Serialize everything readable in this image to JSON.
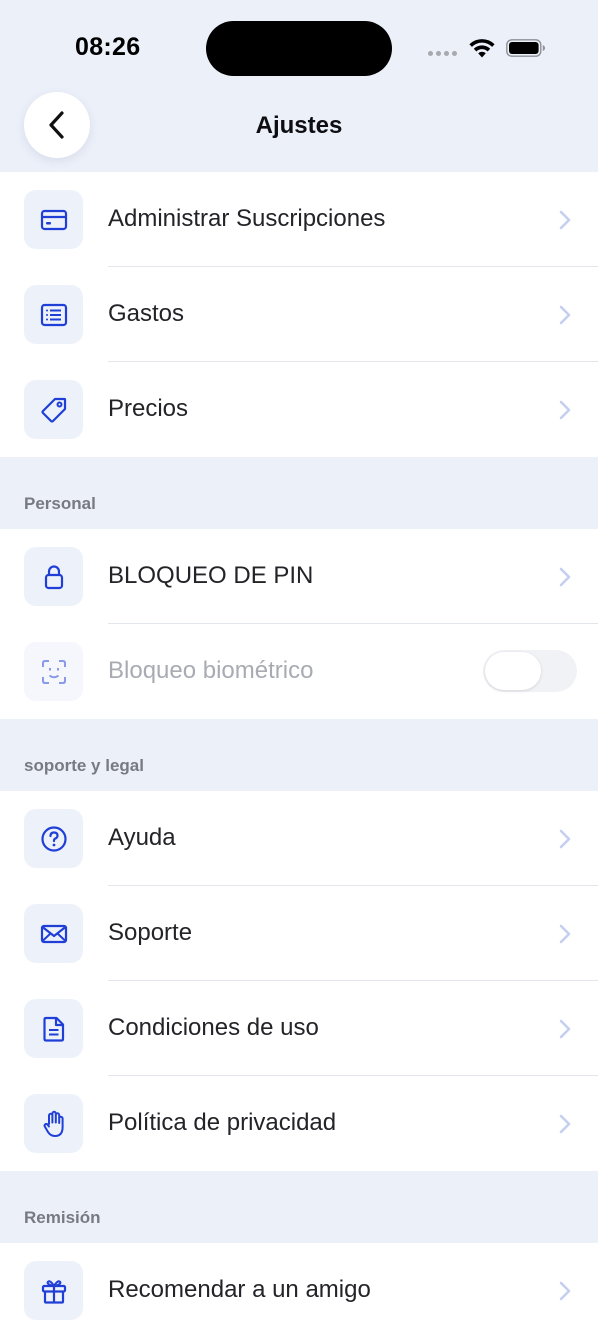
{
  "status": {
    "time": "08:26"
  },
  "nav": {
    "title": "Ajustes"
  },
  "groups": {
    "top": [
      {
        "label": "Administrar Suscripciones",
        "icon": "credit-card-icon"
      },
      {
        "label": "Gastos",
        "icon": "receipt-list-icon"
      },
      {
        "label": "Precios",
        "icon": "price-tag-icon"
      }
    ],
    "personal": {
      "header": "Personal",
      "items": [
        {
          "label": "BLOQUEO DE PIN",
          "icon": "lock-icon"
        },
        {
          "label": "Bloqueo biométrico",
          "icon": "face-id-icon",
          "toggle_on": false,
          "disabled": true
        }
      ]
    },
    "support": {
      "header": "soporte y legal",
      "items": [
        {
          "label": "Ayuda",
          "icon": "help-circle-icon"
        },
        {
          "label": "Soporte",
          "icon": "mail-icon"
        },
        {
          "label": "Condiciones de uso",
          "icon": "document-icon"
        },
        {
          "label": "Política de privacidad",
          "icon": "hand-stop-icon"
        }
      ]
    },
    "referral": {
      "header": "Remisión",
      "items": [
        {
          "label": "Recomendar a un amigo",
          "icon": "gift-icon"
        }
      ]
    }
  },
  "colors": {
    "accent": "#1f3fd6",
    "background": "#ecf0f9",
    "icon_box": "#edf1fa",
    "chevron": "#c5d0f0"
  }
}
